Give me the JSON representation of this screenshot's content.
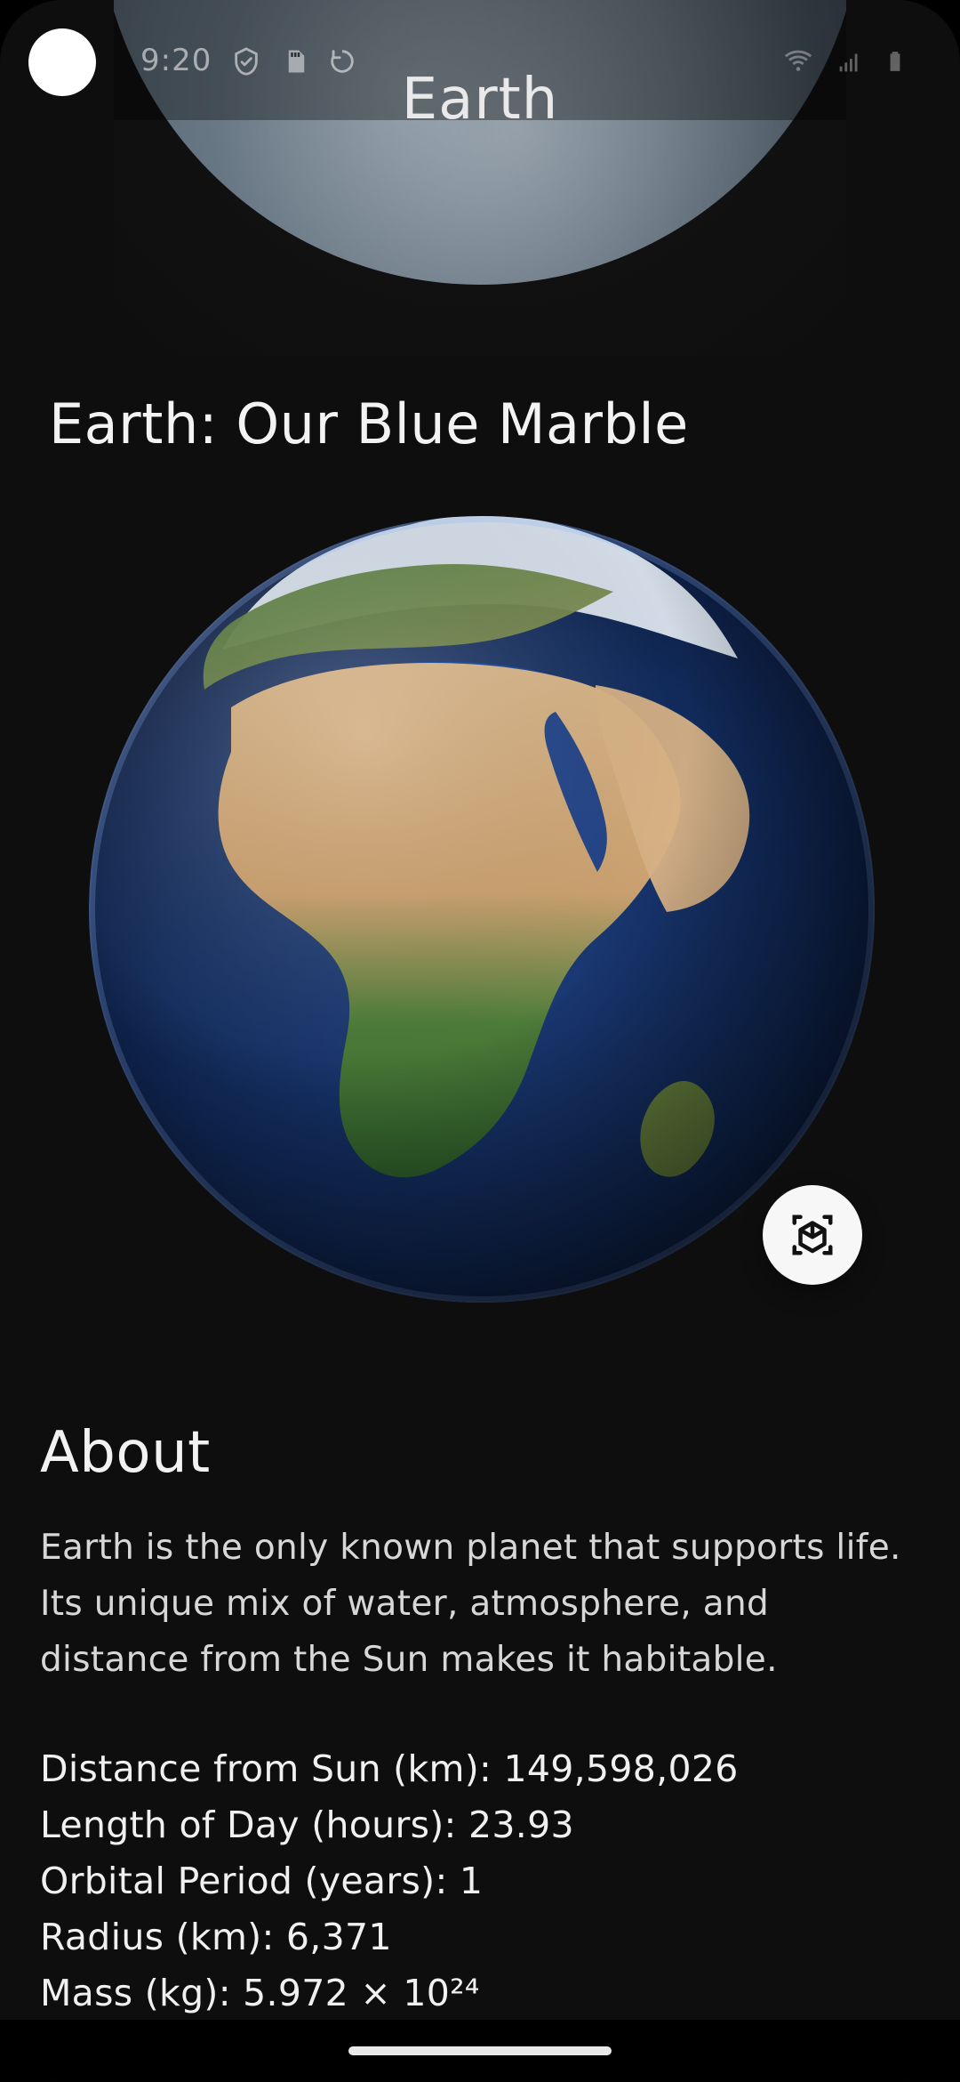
{
  "status_bar": {
    "time": "9:20"
  },
  "app_bar": {
    "title": "Earth"
  },
  "main": {
    "headline": "Earth: Our Blue Marble",
    "ar_icon": "ar-cube-icon",
    "about": {
      "title": "About",
      "text": "Earth is the only known planet that supports life. Its unique mix of water, atmosphere, and distance from the Sun makes it habitable."
    },
    "facts": [
      "Distance from Sun (km): 149,598,026",
      "Length of Day (hours): 23.93",
      "Orbital Period (years): 1",
      "Radius (km): 6,371",
      "Mass (kg): 5.972 × 10²⁴"
    ]
  },
  "colors": {
    "background": "#0e0e0e",
    "ocean": "#112a5a",
    "land": "#c7a26f",
    "vegetation": "#3f7a35",
    "ar_button": "#f7f7f7"
  }
}
